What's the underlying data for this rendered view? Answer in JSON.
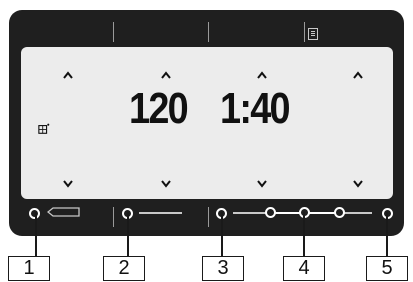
{
  "display": {
    "values": [
      "120",
      "1:40"
    ],
    "top_icon": "document-icon",
    "program_icon": "steam-program-icon"
  },
  "buttons": [
    {
      "label": "1",
      "icon": "back-icon"
    },
    {
      "label": "2",
      "icon": "dash-icon"
    },
    {
      "label": "3",
      "icon": "dash-icon"
    },
    {
      "label": "4",
      "icon": "slider-icon"
    },
    {
      "label": "5",
      "icon": "dash-icon"
    }
  ],
  "colors": {
    "panel": "#1f1f1f",
    "screen": "#ececec",
    "text": "#111111"
  }
}
